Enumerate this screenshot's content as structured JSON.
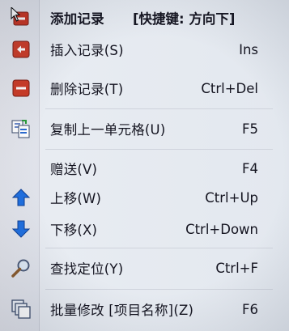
{
  "menu": {
    "items": [
      {
        "label": "添加记录",
        "shortcut": "[快捷键: 方向下]",
        "icon": "add-record-icon"
      },
      {
        "label": "插入记录(S)",
        "shortcut": "Ins",
        "icon": "insert-record-icon"
      },
      {
        "label": "删除记录(T)",
        "shortcut": "Ctrl+Del",
        "icon": "delete-record-icon"
      },
      {
        "label": "复制上一单元格(U)",
        "shortcut": "F5",
        "icon": "copy-cell-icon"
      },
      {
        "label": "赠送(V)",
        "shortcut": "F4",
        "icon": ""
      },
      {
        "label": "上移(W)",
        "shortcut": "Ctrl+Up",
        "icon": "arrow-up-icon"
      },
      {
        "label": "下移(X)",
        "shortcut": "Ctrl+Down",
        "icon": "arrow-down-icon"
      },
      {
        "label": "查找定位(Y)",
        "shortcut": "Ctrl+F",
        "icon": "search-icon"
      },
      {
        "label": "批量修改 [项目名称](Z)",
        "shortcut": "F6",
        "icon": "batch-edit-icon"
      }
    ]
  },
  "colors": {
    "red_icon": "#c8321f",
    "blue_arrow": "#1f6fe0",
    "text": "#141420"
  }
}
